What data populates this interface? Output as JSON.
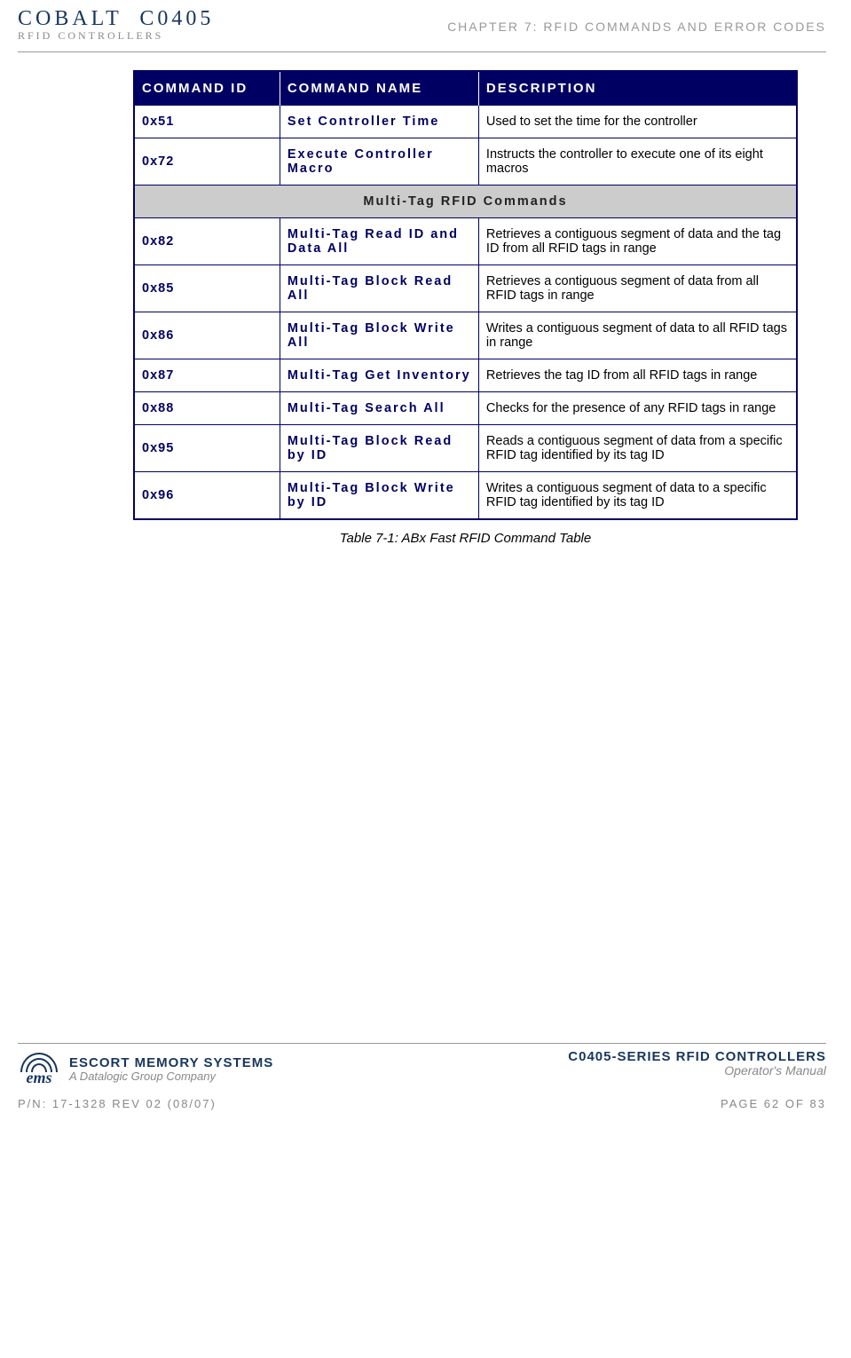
{
  "header": {
    "logo_line1_a": "COBALT",
    "logo_line1_b": "C0405",
    "logo_line2": "RFID CONTROLLERS",
    "chapter": "CHAPTER 7: RFID COMMANDS AND ERROR CODES"
  },
  "table": {
    "headers": {
      "id": "COMMAND ID",
      "name": "COMMAND NAME",
      "desc": "DESCRIPTION"
    },
    "rows_a": [
      {
        "id": "0x51",
        "name": "Set Controller Time",
        "desc": "Used to set the time for the controller"
      },
      {
        "id": "0x72",
        "name": "Execute Controller Macro",
        "desc": "Instructs the controller to execute one of its eight macros"
      }
    ],
    "section_label": "Multi-Tag RFID Commands",
    "rows_b": [
      {
        "id": "0x82",
        "name": "Multi-Tag Read ID and Data All",
        "desc": "Retrieves a contiguous segment of data and the tag ID from all RFID tags in range"
      },
      {
        "id": "0x85",
        "name": "Multi-Tag Block Read All",
        "desc": "Retrieves a contiguous segment of data from all RFID tags in range"
      },
      {
        "id": "0x86",
        "name": "Multi-Tag Block Write All",
        "desc": "Writes a contiguous segment of data to all RFID tags in range"
      },
      {
        "id": "0x87",
        "name": "Multi-Tag Get Inventory",
        "desc": "Retrieves the tag ID from all RFID tags in range"
      },
      {
        "id": "0x88",
        "name": "Multi-Tag Search All",
        "desc": "Checks for the presence of any RFID tags in range"
      },
      {
        "id": "0x95",
        "name": "Multi-Tag Block Read by ID",
        "desc": "Reads a contiguous segment of data from a specific RFID tag identified by its tag ID"
      },
      {
        "id": "0x96",
        "name": "Multi-Tag Block Write by ID",
        "desc": "Writes a contiguous segment of data to a specific RFID tag identified by its tag ID"
      }
    ],
    "caption": "Table 7-1: ABx Fast RFID Command Table"
  },
  "footer": {
    "left1": "ESCORT MEMORY SYSTEMS",
    "left2": "A Datalogic Group Company",
    "ems": "ems",
    "right1": "C0405-SERIES RFID CONTROLLERS",
    "right2": "Operator's Manual",
    "pn": "P/N: 17-1328 REV 02 (08/07)",
    "page": "PAGE 62 OF 83"
  }
}
